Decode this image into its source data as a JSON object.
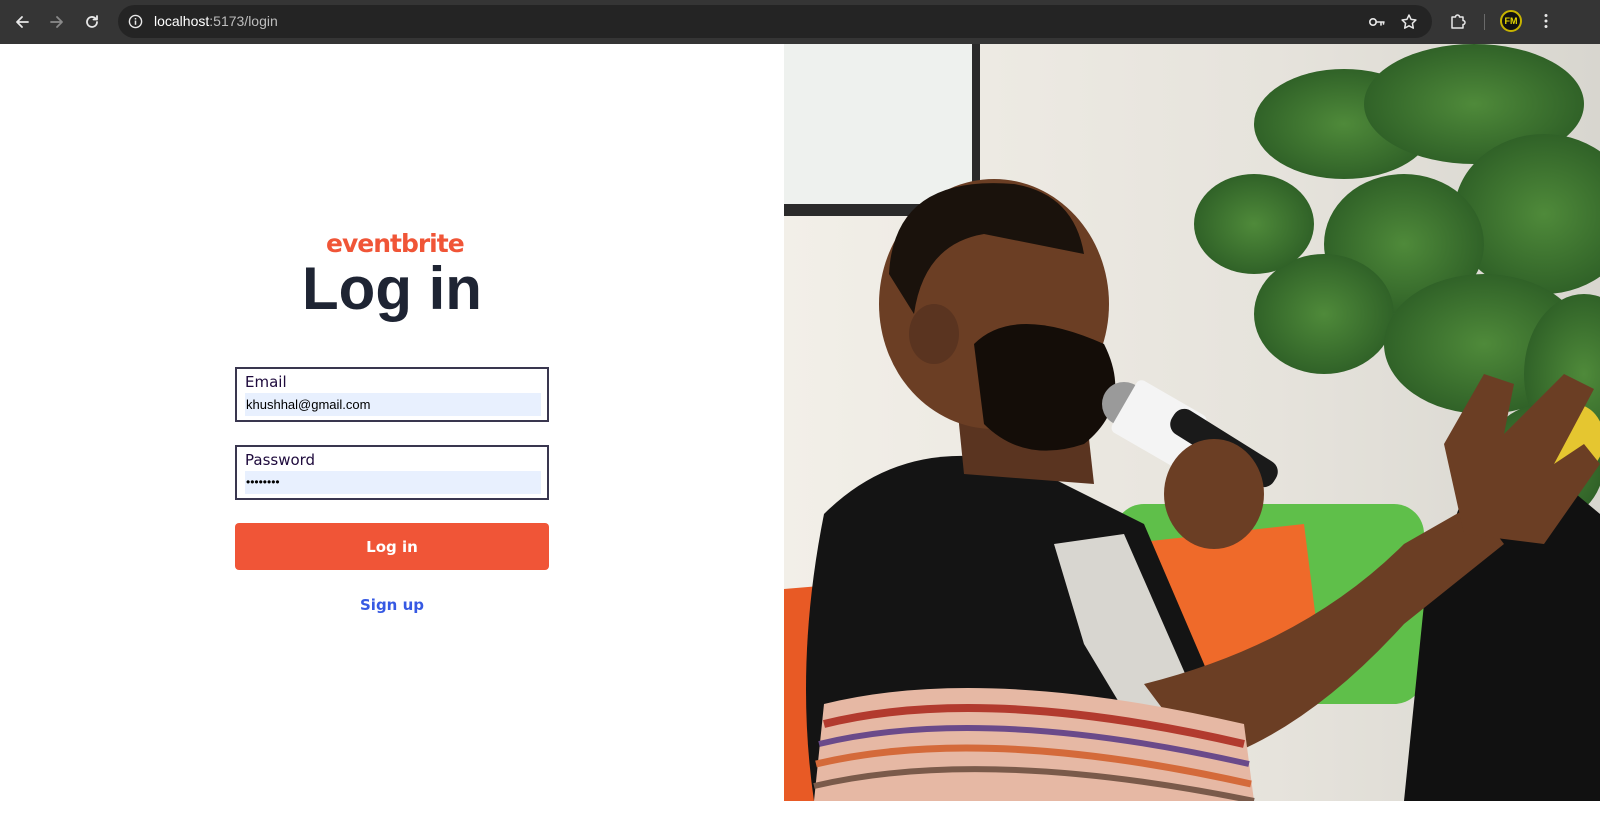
{
  "browser": {
    "url_host": "localhost",
    "url_path": ":5173/login",
    "profile_initials": "FM",
    "icons": [
      "back-icon",
      "forward-icon",
      "reload-icon",
      "site-info-icon",
      "password-key-icon",
      "bookmark-star-icon",
      "extensions-icon",
      "menu-kebab-icon"
    ]
  },
  "brand": {
    "logo_text": "eventbrite",
    "accent_color": "#f05537"
  },
  "login": {
    "title": "Log in",
    "email_label": "Email",
    "email_value": "khushhal@gmail.com",
    "password_label": "Password",
    "password_value": "••••••••",
    "submit_label": "Log in",
    "signup_link": "Sign up"
  },
  "hero_image": {
    "alt": "photo"
  }
}
